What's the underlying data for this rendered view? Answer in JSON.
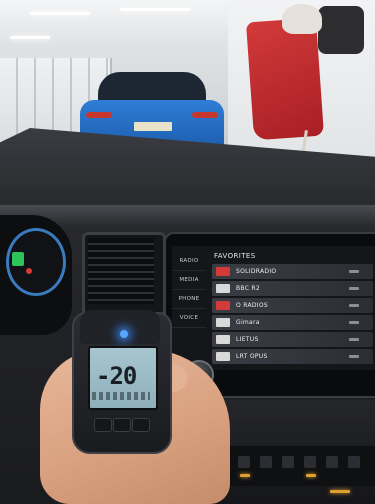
{
  "infotainment": {
    "sidebar": [
      "RADIO",
      "MEDIA",
      "PHONE",
      "VOICE"
    ],
    "list_title": "FAVORITES",
    "stations": [
      {
        "name": "SOLIDRADIO",
        "logo": "red"
      },
      {
        "name": "BBC R2",
        "logo": "white"
      },
      {
        "name": "O RADIOS",
        "logo": "red"
      },
      {
        "name": "Gimara",
        "logo": "white"
      },
      {
        "name": "LIETUS",
        "logo": "white"
      },
      {
        "name": "LRT OPUS",
        "logo": "white"
      }
    ]
  },
  "thermometer": {
    "reading": "-20"
  }
}
